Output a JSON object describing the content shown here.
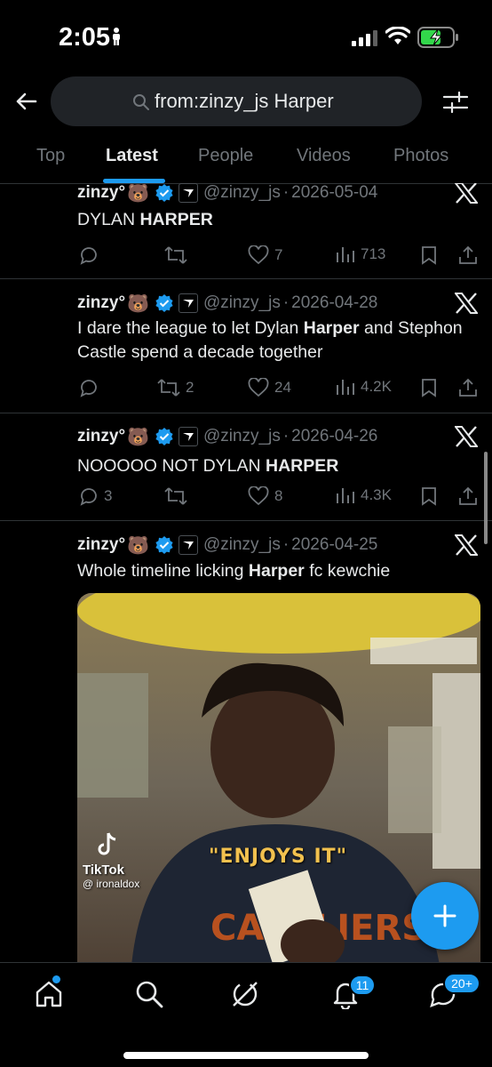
{
  "status_bar": {
    "time": "2:05"
  },
  "search": {
    "query": "from:zinzy_js Harper"
  },
  "tabs": [
    {
      "label": "Top"
    },
    {
      "label": "Latest"
    },
    {
      "label": "People"
    },
    {
      "label": "Videos"
    },
    {
      "label": "Photos"
    }
  ],
  "active_tab": "Latest",
  "tweets": [
    {
      "name": "zinzy°",
      "emoji": "🐻",
      "handle": "@zinzy_js",
      "date": "2026-05-04",
      "text_parts": [
        "DYLAN ",
        "HARPER",
        ""
      ],
      "replies": "",
      "reposts": "",
      "likes": "7",
      "views": "713"
    },
    {
      "name": "zinzy°",
      "emoji": "🐻",
      "handle": "@zinzy_js",
      "date": "2026-04-28",
      "text_parts": [
        "I dare the league to let Dylan ",
        "Harper",
        " and Stephon Castle spend a decade together"
      ],
      "replies": "",
      "reposts": "2",
      "likes": "24",
      "views": "4.2K"
    },
    {
      "name": "zinzy°",
      "emoji": "🐻",
      "handle": "@zinzy_js",
      "date": "2026-04-26",
      "text_parts": [
        "NOOOOO NOT DYLAN ",
        "HARPER",
        ""
      ],
      "replies": "3",
      "reposts": "",
      "likes": "8",
      "views": "4.3K"
    },
    {
      "name": "zinzy°",
      "emoji": "🐻",
      "handle": "@zinzy_js",
      "date": "2026-04-25",
      "text_parts": [
        "Whole timeline licking ",
        "Harper",
        " fc kewchie"
      ],
      "media": {
        "caption": "\"ENJOYS IT\"",
        "tiktok_label": "TikTok",
        "tiktok_user": "@ ironaldox",
        "shirt_text": "CAVALIERS"
      }
    }
  ],
  "bottom_nav": {
    "notifications_badge": "11",
    "messages_badge": "20+"
  },
  "colors": {
    "accent": "#1d9bf0",
    "muted": "#71767b",
    "background": "#000000",
    "divider": "#2f3336"
  }
}
